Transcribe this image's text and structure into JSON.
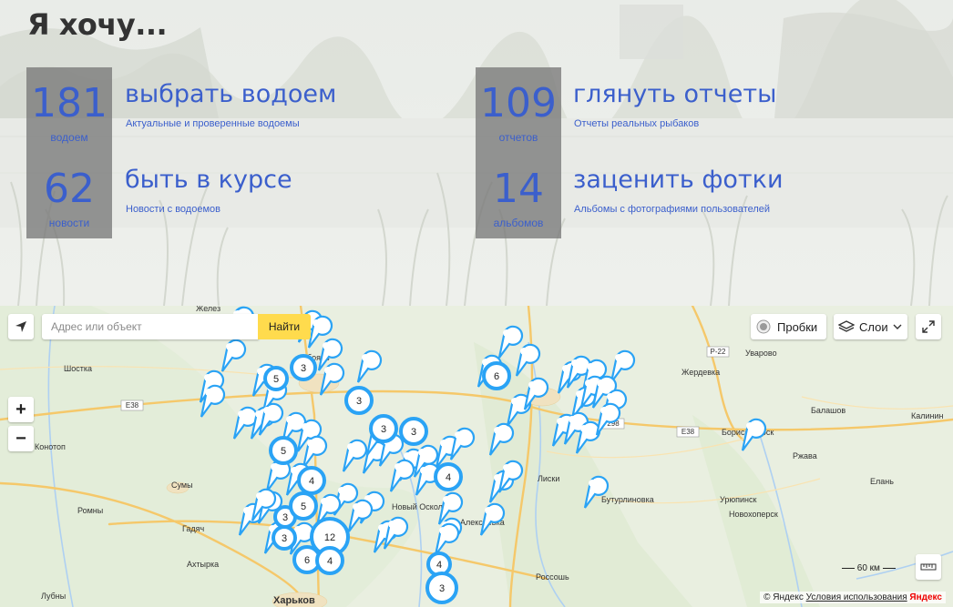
{
  "hero": {
    "title": "Я хочу...",
    "stats": [
      {
        "number": "181",
        "unit": "водоем",
        "link": "выбрать водоем",
        "description": "Актуальные и проверенные водоемы"
      },
      {
        "number": "62",
        "unit": "новости",
        "link": "быть в курсе",
        "description": "Новости с водоемов"
      },
      {
        "number": "109",
        "unit": "отчетов",
        "link": "глянуть отчеты",
        "description": "Отчеты реальных рыбаков"
      },
      {
        "number": "14",
        "unit": "альбомов",
        "link": "заценить фотки",
        "description": "Альбомы с фотографиями пользователей"
      }
    ]
  },
  "map": {
    "search_placeholder": "Адрес или объект",
    "find_label": "Найти",
    "traffic_label": "Пробки",
    "layers_label": "Слои",
    "zoom_in": "+",
    "zoom_out": "−",
    "scale_label": "60 км",
    "copyright": "© Яндекс",
    "terms_label": "Условия использования",
    "brand": "Яндекс",
    "colors": {
      "marker": "#2aa3f5",
      "road": "#f5c86a",
      "water": "#aed0f2",
      "land": "#eaf0e0"
    },
    "places": [
      "Шостка",
      "Конотоп",
      "Сумы",
      "Ромны",
      "Гадяч",
      "Ахтырка",
      "Лубны",
      "Харьков",
      "Новый Оскол",
      "Алексеевка",
      "Лиски",
      "Бутурлиновка",
      "Россошь",
      "Жердевка",
      "Уварово",
      "Балашов",
      "Калинин",
      "Борисоглебск",
      "Новохоперск",
      "Урюпинск",
      "Елань",
      "Желез",
      "Ржава",
      "Обоянь"
    ],
    "road_labels": [
      "E38",
      "E38",
      "P-22",
      "298"
    ],
    "clusters": [
      "5",
      "3",
      "3",
      "3",
      "3",
      "6",
      "5",
      "4",
      "4",
      "3",
      "5",
      "3",
      "12",
      "6",
      "4",
      "4",
      "3"
    ]
  }
}
